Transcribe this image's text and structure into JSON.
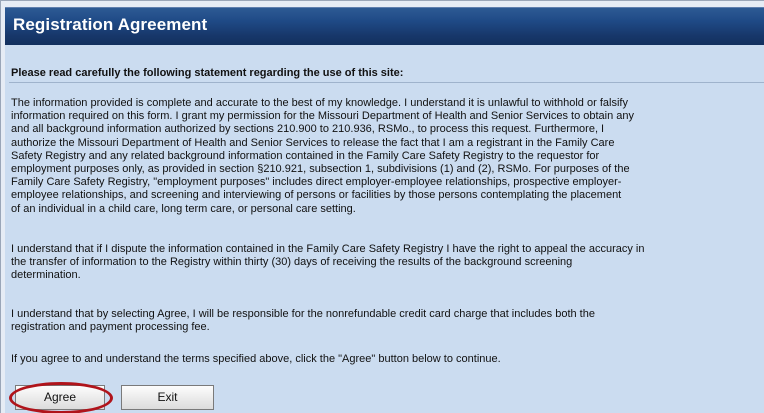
{
  "header": {
    "title": "Registration Agreement"
  },
  "intro": "Please read carefully the following statement regarding the use of this site:",
  "paragraphs": [
    {
      "lines": [
        "The information provided is complete and accurate to the best of my knowledge.  I understand it is unlawful to withhold or falsify",
        "information required on this form.  I grant my permission for the Missouri Department of Health and Senior Services to obtain any",
        "and all background information authorized by sections 210.900 to 210.936, RSMo., to process this request.  Furthermore, I",
        "authorize the Missouri Department of Health and Senior Services to release the fact that I am a registrant in the Family Care",
        "Safety Registry and any related background information contained in the Family Care Safety Registry to the requestor for",
        "employment purposes only, as provided in section §210.921, subsection 1, subdivisions (1) and (2), RSMo. For purposes of the",
        "Family Care Safety Registry, \"employment purposes\" includes direct employer-employee relationships, prospective employer-",
        "employee relationships, and screening and interviewing of persons or facilities by those persons contemplating the placement",
        "of an individual in a child care, long term care, or personal care setting."
      ]
    },
    {
      "lines": [
        "I understand that if I dispute the information contained in the Family Care Safety Registry I have the right to appeal the accuracy in",
        "the transfer of information to the Registry within thirty (30) days of receiving the results of the background screening",
        "determination."
      ]
    },
    {
      "lines": [
        "I understand that by selecting Agree, I will be responsible for the nonrefundable credit card charge that includes both the",
        "registration and payment processing fee."
      ]
    },
    {
      "lines": [
        "If you agree to and understand the terms specified above, click the \"Agree\" button below to continue."
      ]
    }
  ],
  "buttons": {
    "agree": "Agree",
    "exit": "Exit"
  },
  "colors": {
    "header_bg": "#1f4a86",
    "content_bg": "#cbdcf0",
    "highlight": "#b0141b"
  }
}
